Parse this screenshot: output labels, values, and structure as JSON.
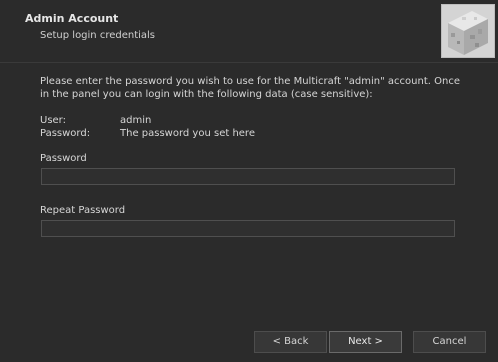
{
  "header": {
    "title": "Admin Account",
    "subtitle": "Setup login credentials",
    "logo_icon": "multicraft-stone-block-icon"
  },
  "intro_text": "Please enter the password you wish to use for the Multicraft \"admin\" account. Once in the panel you can login with the following data (case sensitive):",
  "credentials": {
    "user_key": "User:",
    "user_value": "admin",
    "password_key": "Password:",
    "password_value": "The password you set here"
  },
  "fields": {
    "password_label": "Password",
    "password_value": "",
    "repeat_label": "Repeat Password",
    "repeat_value": ""
  },
  "buttons": {
    "back": "< Back",
    "next": "Next >",
    "cancel": "Cancel"
  }
}
